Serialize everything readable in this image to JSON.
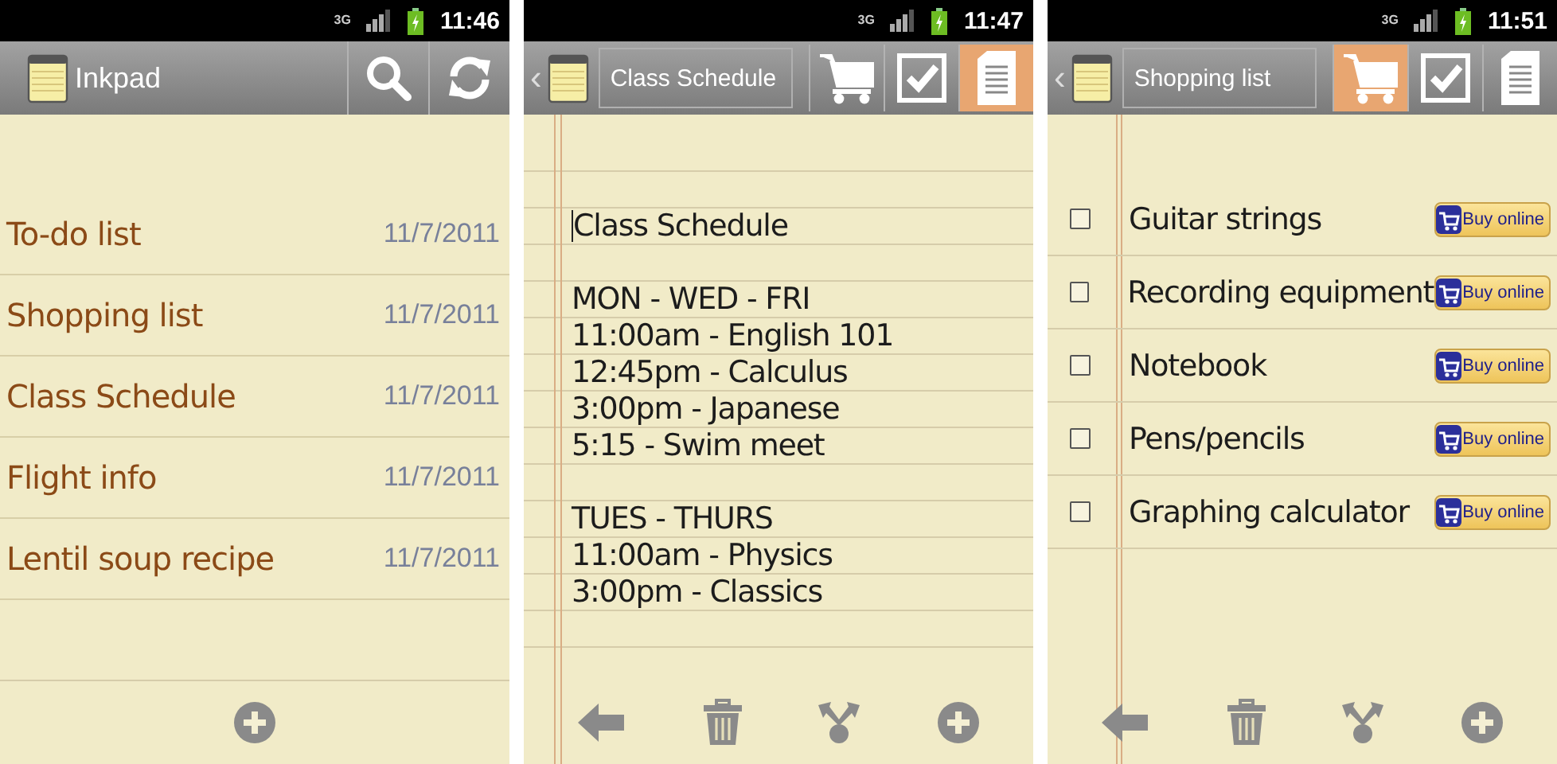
{
  "screens": [
    {
      "kind": "note_list",
      "status": {
        "network": "3G",
        "time": "11:46"
      },
      "action_bar": {
        "title": "Inkpad",
        "buttons": [
          {
            "kind": "search"
          },
          {
            "kind": "refresh"
          }
        ]
      },
      "notes": [
        {
          "title": "To-do list",
          "date": "11/7/2011"
        },
        {
          "title": "Shopping list",
          "date": "11/7/2011"
        },
        {
          "title": "Class Schedule",
          "date": "11/7/2011"
        },
        {
          "title": "Flight info",
          "date": "11/7/2011"
        },
        {
          "title": "Lentil soup recipe",
          "date": "11/7/2011"
        }
      ],
      "bottom_bar": [
        {
          "kind": "add"
        }
      ]
    },
    {
      "kind": "text_note",
      "status": {
        "network": "3G",
        "time": "11:47"
      },
      "action_bar": {
        "back": "‹",
        "title": "Class Schedule",
        "buttons": [
          {
            "kind": "cart",
            "selected": false
          },
          {
            "kind": "checklist",
            "selected": false
          },
          {
            "kind": "text",
            "selected": true
          }
        ]
      },
      "cursor_at_start": true,
      "blocks": [
        {
          "lines": [
            "Class Schedule"
          ]
        },
        {
          "lines": [
            "MON - WED - FRI",
            "11:00am - English 101",
            "12:45pm - Calculus",
            "3:00pm - Japanese",
            "5:15 - Swim meet"
          ]
        },
        {
          "lines": [
            "TUES - THURS",
            "11:00am - Physics",
            "3:00pm - Classics"
          ]
        }
      ],
      "bottom_bar": [
        {
          "kind": "back"
        },
        {
          "kind": "delete"
        },
        {
          "kind": "share"
        },
        {
          "kind": "add"
        }
      ]
    },
    {
      "kind": "shopping_list",
      "status": {
        "network": "3G",
        "time": "11:51"
      },
      "action_bar": {
        "back": "‹",
        "title": "Shopping list",
        "buttons": [
          {
            "kind": "cart",
            "selected": true
          },
          {
            "kind": "checklist",
            "selected": false
          },
          {
            "kind": "text",
            "selected": false
          }
        ]
      },
      "items": [
        {
          "text": "Guitar strings",
          "checked": false,
          "action": "Buy online"
        },
        {
          "text": "Recording equipment",
          "checked": false,
          "action": "Buy online"
        },
        {
          "text": "Notebook",
          "checked": false,
          "action": "Buy online"
        },
        {
          "text": "Pens/pencils",
          "checked": false,
          "action": "Buy online"
        },
        {
          "text": "Graphing calculator",
          "checked": false,
          "action": "Buy online"
        }
      ],
      "bottom_bar": [
        {
          "kind": "back"
        },
        {
          "kind": "delete"
        },
        {
          "kind": "share"
        },
        {
          "kind": "add"
        }
      ]
    }
  ]
}
